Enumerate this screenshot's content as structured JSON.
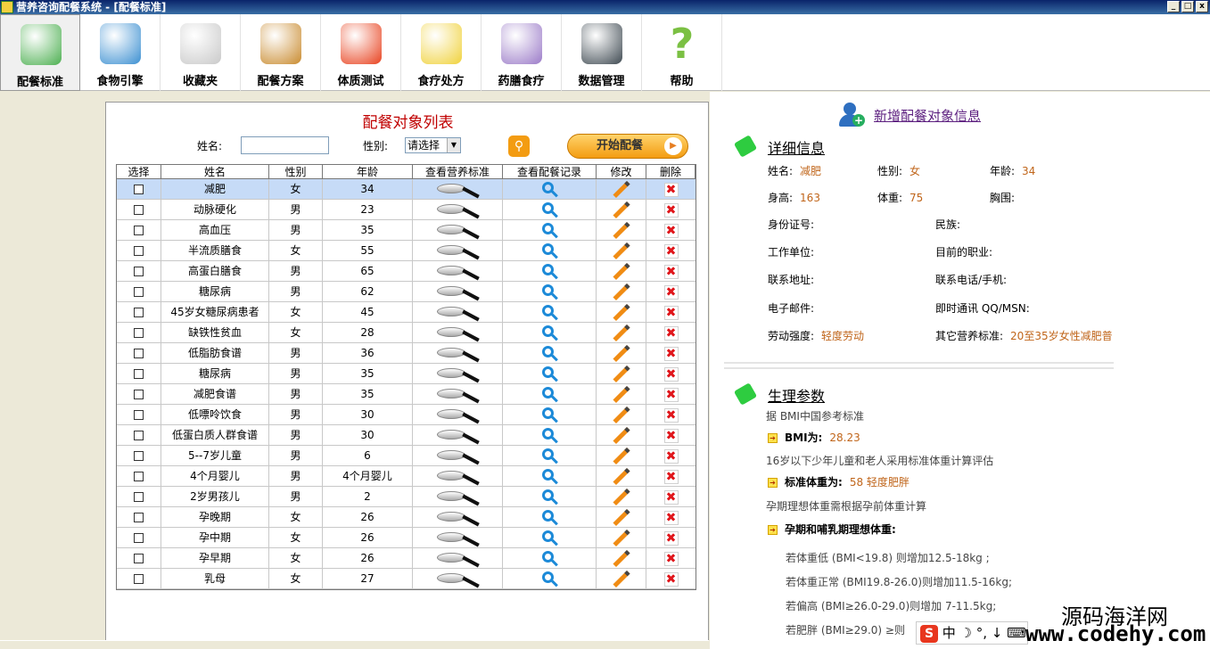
{
  "window": {
    "title": "营养咨询配餐系统 - [配餐标准]",
    "min": "_",
    "max": "□",
    "close": "x"
  },
  "toolbar": [
    {
      "label": "配餐标准",
      "color": "#4caf50"
    },
    {
      "label": "食物引擎",
      "color": "#3b8fd1"
    },
    {
      "label": "收藏夹",
      "color": "#c9c9c9"
    },
    {
      "label": "配餐方案",
      "color": "#c98b2f"
    },
    {
      "label": "体质测试",
      "color": "#e8421f"
    },
    {
      "label": "食疗处方",
      "color": "#f0d23c"
    },
    {
      "label": "药膳食疗",
      "color": "#9b7bc8"
    },
    {
      "label": "数据管理",
      "color": "#3f4a52"
    },
    {
      "label": "帮助",
      "color": "#7bc043"
    }
  ],
  "list": {
    "title": "配餐对象列表",
    "name_label": "姓名:",
    "name_value": "",
    "gender_label": "性别:",
    "gender_value": "请选择",
    "start_button": "开始配餐",
    "columns": [
      "选择",
      "姓名",
      "性别",
      "年龄",
      "查看营养标准",
      "查看配餐记录",
      "修改",
      "删除"
    ],
    "rows": [
      {
        "name": "减肥",
        "gender": "女",
        "age": "34"
      },
      {
        "name": "动脉硬化",
        "gender": "男",
        "age": "23"
      },
      {
        "name": "高血压",
        "gender": "男",
        "age": "35"
      },
      {
        "name": "半流质膳食",
        "gender": "女",
        "age": "55"
      },
      {
        "name": "高蛋白膳食",
        "gender": "男",
        "age": "65"
      },
      {
        "name": "糖尿病",
        "gender": "男",
        "age": "62"
      },
      {
        "name": "45岁女糖尿病患者",
        "gender": "女",
        "age": "45"
      },
      {
        "name": "缺铁性贫血",
        "gender": "女",
        "age": "28"
      },
      {
        "name": "低脂肪食谱",
        "gender": "男",
        "age": "36"
      },
      {
        "name": "糖尿病",
        "gender": "男",
        "age": "35"
      },
      {
        "name": "减肥食谱",
        "gender": "男",
        "age": "35"
      },
      {
        "name": "低嘌呤饮食",
        "gender": "男",
        "age": "30"
      },
      {
        "name": "低蛋白质人群食谱",
        "gender": "男",
        "age": "30"
      },
      {
        "name": "5--7岁儿童",
        "gender": "男",
        "age": "6"
      },
      {
        "name": "4个月婴儿",
        "gender": "男",
        "age": "4个月婴儿"
      },
      {
        "name": "2岁男孩儿",
        "gender": "男",
        "age": "2"
      },
      {
        "name": "孕晚期",
        "gender": "女",
        "age": "26"
      },
      {
        "name": "孕中期",
        "gender": "女",
        "age": "26"
      },
      {
        "name": "孕早期",
        "gender": "女",
        "age": "26"
      },
      {
        "name": "乳母",
        "gender": "女",
        "age": "27"
      }
    ]
  },
  "detail": {
    "add_link": "新增配餐对象信息",
    "section_title": "详细信息",
    "fields": [
      {
        "label": "姓名:",
        "value": "减肥"
      },
      {
        "label": "性别:",
        "value": "女"
      },
      {
        "label": "年龄:",
        "value": "34"
      },
      {
        "label": "身高:",
        "value": "163"
      },
      {
        "label": "体重:",
        "value": "75"
      },
      {
        "label": "胸围:",
        "value": ""
      },
      {
        "label": "身份证号:",
        "value": ""
      },
      {
        "label": "民族:",
        "value": ""
      },
      {
        "label": "工作单位:",
        "value": ""
      },
      {
        "label": "目前的职业:",
        "value": ""
      },
      {
        "label": "联系地址:",
        "value": ""
      },
      {
        "label": "联系电话/手机:",
        "value": ""
      },
      {
        "label": "电子邮件:",
        "value": ""
      },
      {
        "label": "即时通讯 QQ/MSN:",
        "value": ""
      },
      {
        "label": "劳动强度:",
        "value": "轻度劳动"
      },
      {
        "label": "其它营养标准:",
        "value": "20至35岁女性减肥普"
      }
    ]
  },
  "physio": {
    "section_title": "生理参数",
    "ref": "据 BMI中国参考标准",
    "bmi_label": "BMI为:",
    "bmi_value": "28.23",
    "note1": "16岁以下少年儿童和老人采用标准体重计算评估",
    "std_label": "标准体重为:",
    "std_value": "58 轻度肥胖",
    "note2": "孕期理想体重需根据孕前体重计算",
    "preg_label": "孕期和哺乳期理想体重:",
    "lines": [
      "若体重低  (BMI<19.8) 则增加12.5-18kg ;",
      "若体重正常  (BMI19.8-26.0)则增加11.5-16kg;",
      "若偏高  (BMI≥26.0-29.0)则增加 7-11.5kg;",
      "若肥胖  (BMI≥29.0) ≥则"
    ]
  },
  "overlay": {
    "ime": "中 ☽ °, ↓ ⌨",
    "ime_logo": "S",
    "watermark": "源码海洋网",
    "watermark_url": "www.codehy.com"
  }
}
